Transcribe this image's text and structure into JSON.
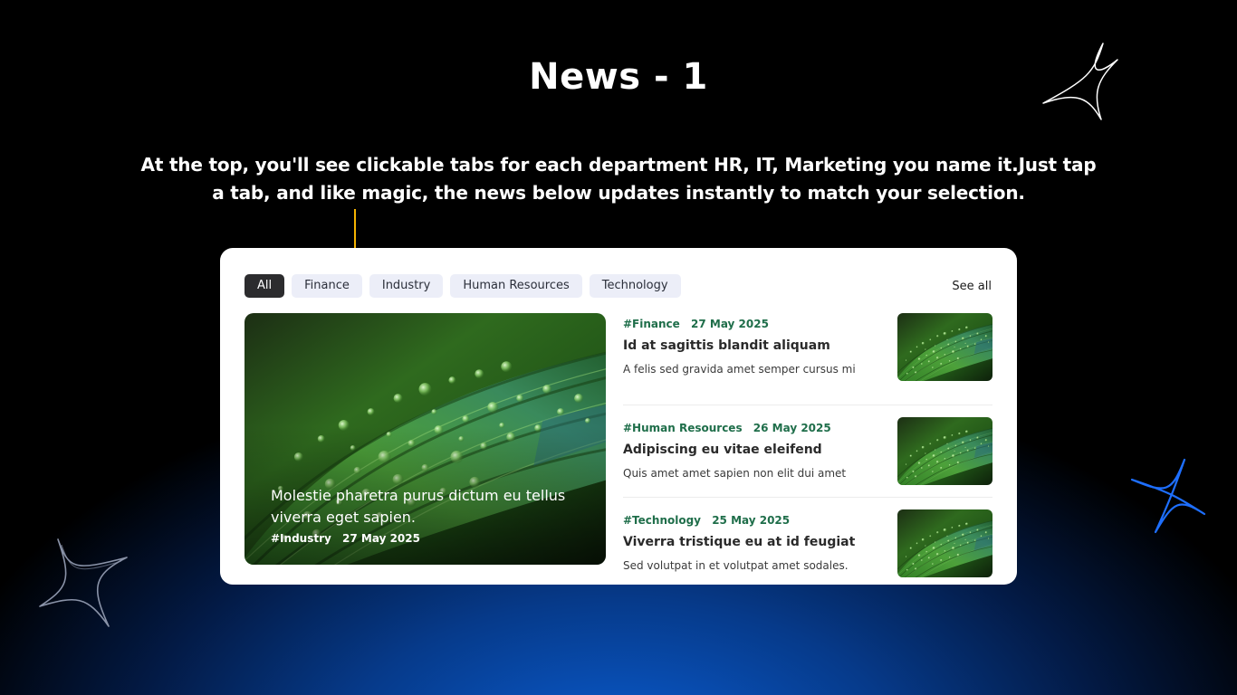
{
  "page": {
    "title": "News - 1",
    "description": "At the top, you'll see clickable tabs for each department HR, IT, Marketing you name it.Just tap a tab, and like magic, the news below updates instantly to match your selection."
  },
  "colors": {
    "accent_yellow": "#f5b301",
    "active_tab": "#2c2c2e",
    "inactive_tab": "#eceef8",
    "tag_green": "#1f6e4a",
    "background_blue": "#0a5fd6"
  },
  "tabs": [
    {
      "label": "All",
      "active": true
    },
    {
      "label": "Finance",
      "active": false
    },
    {
      "label": "Industry",
      "active": false
    },
    {
      "label": "Human Resources",
      "active": false
    },
    {
      "label": "Technology",
      "active": false
    }
  ],
  "see_all_label": "See all",
  "featured": {
    "headline": "Molestie pharetra purus dictum eu tellus viverra eget sapien.",
    "tag": "#Industry",
    "date": "27 May 2025",
    "image_icon": "leaf-image"
  },
  "news_items": [
    {
      "tag": "#Finance",
      "date": "27 May 2025",
      "title": "Id at sagittis blandit aliquam",
      "excerpt": "A felis sed gravida amet semper cursus mi",
      "image_icon": "leaf-image"
    },
    {
      "tag": "#Human Resources",
      "date": "26 May 2025",
      "title": "Adipiscing eu vitae eleifend",
      "excerpt": "Quis amet amet sapien non elit dui amet",
      "image_icon": "leaf-image"
    },
    {
      "tag": "#Technology",
      "date": "25 May 2025",
      "title": "Viverra tristique eu at id feugiat",
      "excerpt": "Sed volutpat in et volutpat amet sodales.",
      "image_icon": "leaf-image"
    }
  ],
  "decorations": [
    "sparkle-icon-white",
    "sparkle-icon-blue",
    "sparkle-icon-gray"
  ]
}
